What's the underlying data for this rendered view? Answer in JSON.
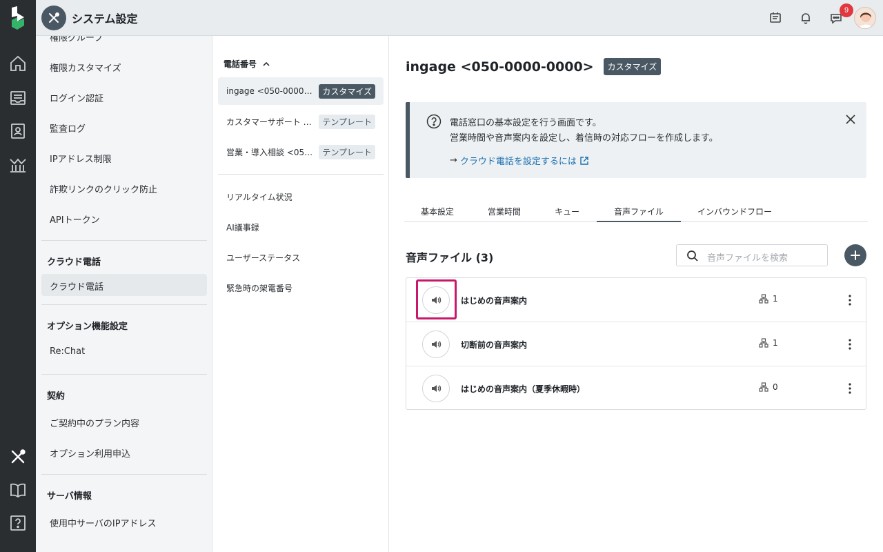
{
  "header": {
    "app_title": "システム設定",
    "notification_count": "9",
    "icons": [
      "logo-icon",
      "tools-icon",
      "announcement-icon",
      "bell-icon",
      "chat-icon",
      "avatar"
    ]
  },
  "rail": {
    "icons": [
      "home-icon",
      "inbox-icon",
      "contacts-icon",
      "analytics-icon",
      "settings-tools-icon",
      "book-icon",
      "help-icon"
    ]
  },
  "nav1": {
    "items_top": [
      "権限グループ",
      "権限カスタマイズ",
      "ログイン認証",
      "監査ログ",
      "IPアドレス制限",
      "詐欺リンクのクリック防止",
      "APIトークン"
    ],
    "section_cloud": {
      "heading": "クラウド電話",
      "items": [
        "クラウド電話"
      ]
    },
    "section_option": {
      "heading": "オプション機能設定",
      "items": [
        "Re:Chat"
      ]
    },
    "section_contract": {
      "heading": "契約",
      "items": [
        "ご契約中のプラン内容",
        "オプション利用申込"
      ]
    },
    "section_server": {
      "heading": "サーバ情報",
      "items": [
        "使用中サーバのIPアドレス"
      ]
    }
  },
  "nav2": {
    "heading": "電話番号",
    "phones": [
      {
        "name": "ingage <050-0000-00…",
        "tag": "カスタマイズ"
      },
      {
        "name": "カスタマーサポート <…",
        "tag": "テンプレート"
      },
      {
        "name": "営業・導入相談 <050-…",
        "tag": "テンプレート"
      }
    ],
    "items": [
      "リアルタイム状況",
      "AI議事録",
      "ユーザーステータス",
      "緊急時の架電番号"
    ]
  },
  "main": {
    "title": "ingage <050-0000-0000>",
    "title_tag": "カスタマイズ",
    "info": {
      "line1": "電話窓口の基本設定を行う画面です。",
      "line2": "営業時間や音声案内を設定し、着信時の対応フローを作成します。",
      "link": "クラウド電話を設定するには",
      "arrow": "→"
    },
    "tabs": [
      "基本設定",
      "営業時間",
      "キュー",
      "音声ファイル",
      "インバウンドフロー"
    ],
    "active_tab": "音声ファイル",
    "list_title": "音声ファイル (3)",
    "search_placeholder": "音声ファイルを検索",
    "files": [
      {
        "name": "はじめの音声案内",
        "count": "1"
      },
      {
        "name": "切断前の音声案内",
        "count": "1"
      },
      {
        "name": "はじめの音声案内（夏季休暇時）",
        "count": "0"
      }
    ]
  },
  "colors": {
    "accent": "#4a5863",
    "highlight": "#c8186c",
    "badge": "#e0383e",
    "link": "#1a6fb0"
  }
}
